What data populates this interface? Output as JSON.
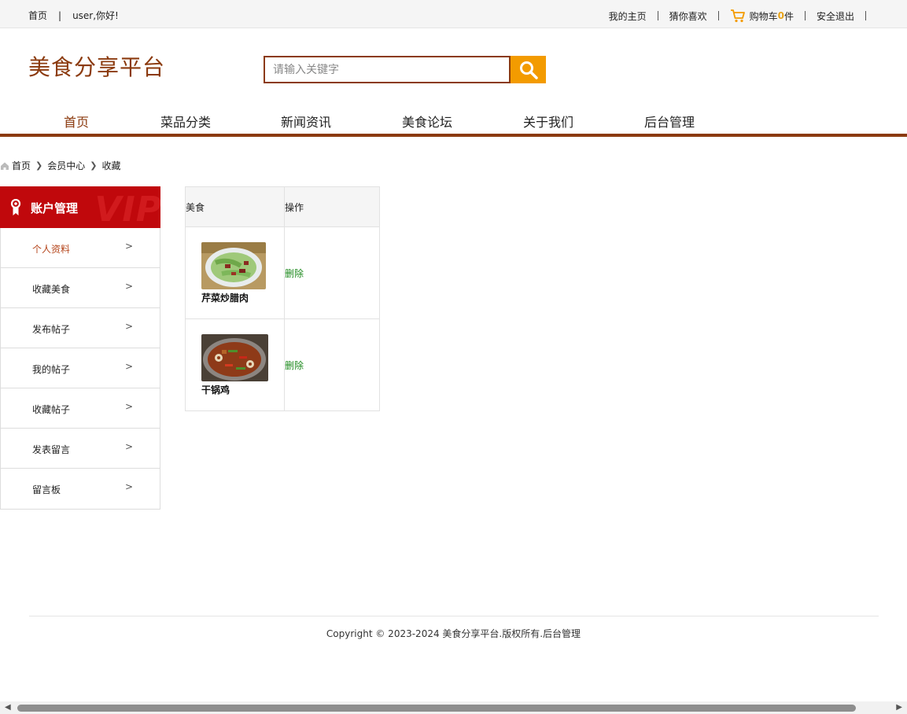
{
  "topbar": {
    "home": "首页",
    "greeting": "user,你好!",
    "separator": "|",
    "my_home": "我的主页",
    "guess": "猜你喜欢",
    "cart_prefix": "购物车",
    "cart_count": "0",
    "cart_suffix": "件",
    "logout": "安全退出"
  },
  "header": {
    "logo": "美食分享平台",
    "search_placeholder": "请输入关键字"
  },
  "nav": {
    "items": [
      {
        "label": "首页",
        "active": true
      },
      {
        "label": "菜品分类"
      },
      {
        "label": "新闻资讯"
      },
      {
        "label": "美食论坛"
      },
      {
        "label": "关于我们"
      },
      {
        "label": "后台管理"
      }
    ]
  },
  "breadcrumb": [
    "首页",
    "会员中心",
    "收藏"
  ],
  "sidebar": {
    "title": "账户管理",
    "watermark": "VIP",
    "items": [
      {
        "label": "个人资料",
        "active": true
      },
      {
        "label": "收藏美食"
      },
      {
        "label": "发布帖子"
      },
      {
        "label": "我的帖子"
      },
      {
        "label": "收藏帖子"
      },
      {
        "label": "发表留言"
      },
      {
        "label": "留言板"
      }
    ],
    "arrow": ">"
  },
  "table": {
    "headers": [
      "美食",
      "操作"
    ],
    "rows": [
      {
        "name": "芹菜炒腊肉",
        "action": "删除"
      },
      {
        "name": "干锅鸡",
        "action": "删除"
      }
    ]
  },
  "footer": {
    "text": "Copyright © 2023-2024 美食分享平台.版权所有.",
    "admin_link": "后台管理"
  },
  "colors": {
    "brand": "#8b3a0e",
    "search_button": "#f39b00",
    "sidebar_header": "#c0080c",
    "delete_link": "#1f8a1f",
    "active_sidebar": "#b5451b"
  }
}
